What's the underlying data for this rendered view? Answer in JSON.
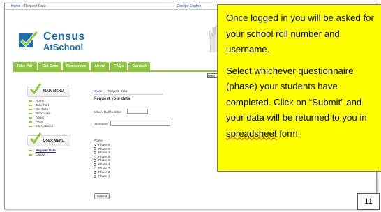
{
  "topbar": {
    "home": "Home",
    "separator": "»",
    "current": "Request Data",
    "lang_irish": "Gaeilge",
    "lang_english": "English"
  },
  "logo": {
    "line1": "Census",
    "line2": "AtSchool"
  },
  "nav": [
    "Take Part",
    "Get Data",
    "Resources",
    "About",
    "FAQs",
    "Contact"
  ],
  "search": {
    "text": "searc"
  },
  "sidebar": {
    "main_menu_title": "MAIN MENU",
    "main_items": [
      "Home",
      "Take Part",
      "Get Data",
      "Resources",
      "About",
      "FAQs",
      "International"
    ],
    "user_menu_title": "USER MENU",
    "user_items": [
      "Request Data",
      "Logout"
    ]
  },
  "content": {
    "crumb_home": "Home",
    "crumb_sep": "»",
    "crumb_current": "Request Data",
    "heading": "Request your data",
    "roll_label": "School Roll Number",
    "username_label": "Username",
    "phase_label": "Phase",
    "phases": [
      "Phase 9",
      "Phase 8",
      "Phase 7",
      "Phase 6",
      "Phase 5",
      "Phase 4",
      "Phase 3",
      "Phase 2",
      "Phase 1"
    ],
    "selected_phase": "Phase 9",
    "submit": "Submit"
  },
  "callout": {
    "para1": "Once logged in you will be asked for your school roll number and username.",
    "para2_before": "Select whichever questionnaire (phase) your students have completed. Click on “Submit” and your data will be returned to you in ",
    "para2_wavy": "spreadsheet",
    "para2_after": " form."
  },
  "page_number": "11",
  "colors": {
    "brand_blue": "#1c6fb5",
    "brand_green": "#8cc63e",
    "callout_yellow": "#ffff00"
  }
}
